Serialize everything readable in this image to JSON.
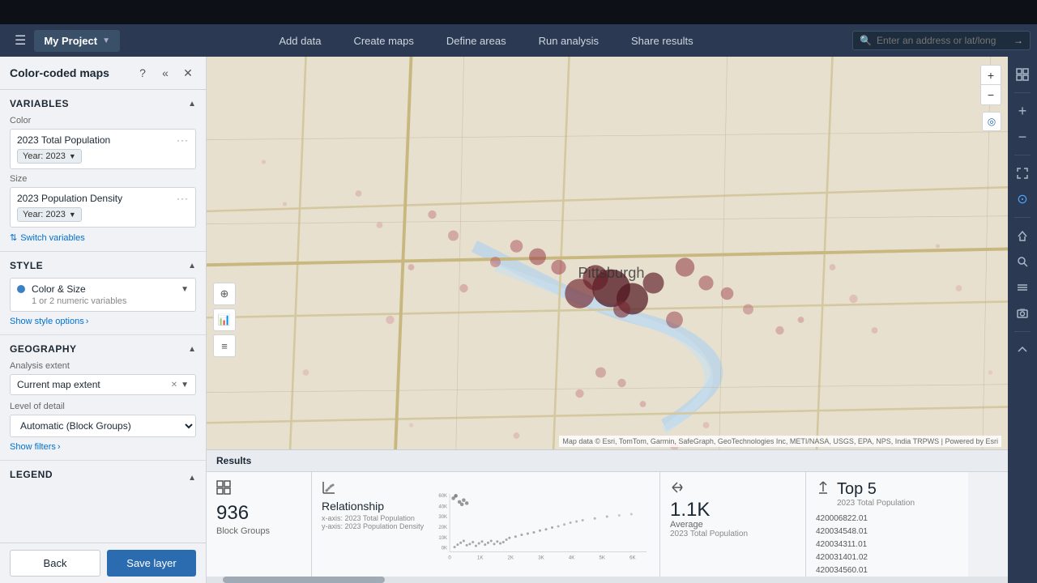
{
  "topbar": {
    "app_name": "My Project",
    "nav_items": [
      {
        "label": "Add data",
        "id": "add-data"
      },
      {
        "label": "Create maps",
        "id": "create-maps"
      },
      {
        "label": "Define areas",
        "id": "define-areas"
      },
      {
        "label": "Run analysis",
        "id": "run-analysis"
      },
      {
        "label": "Share results",
        "id": "share-results"
      }
    ],
    "search_placeholder": "Enter an address or lat/long"
  },
  "panel": {
    "title": "Color-coded maps",
    "sections": {
      "variables": {
        "title": "Variables",
        "color_label": "Color",
        "color_variable": "2023 Total Population",
        "color_year": "Year: 2023",
        "size_label": "Size",
        "size_variable": "2023 Population Density",
        "size_year": "Year: 2023",
        "switch_label": "Switch variables"
      },
      "style": {
        "title": "Style",
        "style_type": "Color & Size",
        "style_subtitle": "1 or 2 numeric variables",
        "show_style_label": "Show style options"
      },
      "geography": {
        "title": "Geography",
        "analysis_extent_label": "Analysis extent",
        "analysis_extent_value": "Current map extent",
        "level_of_detail_label": "Level of detail",
        "level_of_detail_value": "Automatic (Block Groups)",
        "show_filters_label": "Show filters"
      },
      "legend": {
        "title": "Legend"
      }
    },
    "buttons": {
      "back": "Back",
      "save": "Save layer"
    }
  },
  "results": {
    "header": "Results",
    "cards": [
      {
        "icon": "grid-icon",
        "number": "936",
        "label": "Block Groups"
      },
      {
        "icon": "scatter-icon",
        "title": "Relationship",
        "x_axis": "x-axis: 2023 Total Population",
        "y_axis": "y-axis: 2023 Population Density",
        "y_labels": [
          "60K",
          "40K",
          "30K",
          "20K",
          "10K",
          "0K"
        ],
        "x_labels": [
          "0",
          "1K",
          "2K",
          "3K",
          "4K",
          "5K",
          "6K"
        ]
      },
      {
        "icon": "x-icon",
        "number": "1.1K",
        "label": "Average",
        "sublabel": "2023 Total Population"
      },
      {
        "icon": "arrow-up-icon",
        "title": "Top 5",
        "label": "2023 Total Population",
        "items": [
          "420006822.01",
          "420034548.01",
          "420034311.01",
          "420031401.02",
          "420034560.01"
        ]
      }
    ]
  },
  "map": {
    "attribution": "Map data © Esri, TomTom, Garmin, SafeGraph, GeoTechnologies Inc, METI/NASA, USGS, EPA, NPS, India TRPWS | Powered by Esri"
  },
  "toolbar": {
    "buttons": [
      {
        "icon": "grid-squares-icon",
        "label": "grid"
      },
      {
        "icon": "plus-icon",
        "label": "zoom-in"
      },
      {
        "icon": "minus-icon",
        "label": "zoom-out"
      },
      {
        "icon": "expand-icon",
        "label": "fullscreen"
      },
      {
        "icon": "location-dot-icon",
        "label": "location"
      },
      {
        "icon": "home-icon",
        "label": "home"
      },
      {
        "icon": "search-icon",
        "label": "search"
      },
      {
        "icon": "layers-icon",
        "label": "layers"
      },
      {
        "icon": "screenshot-icon",
        "label": "screenshot"
      }
    ]
  }
}
